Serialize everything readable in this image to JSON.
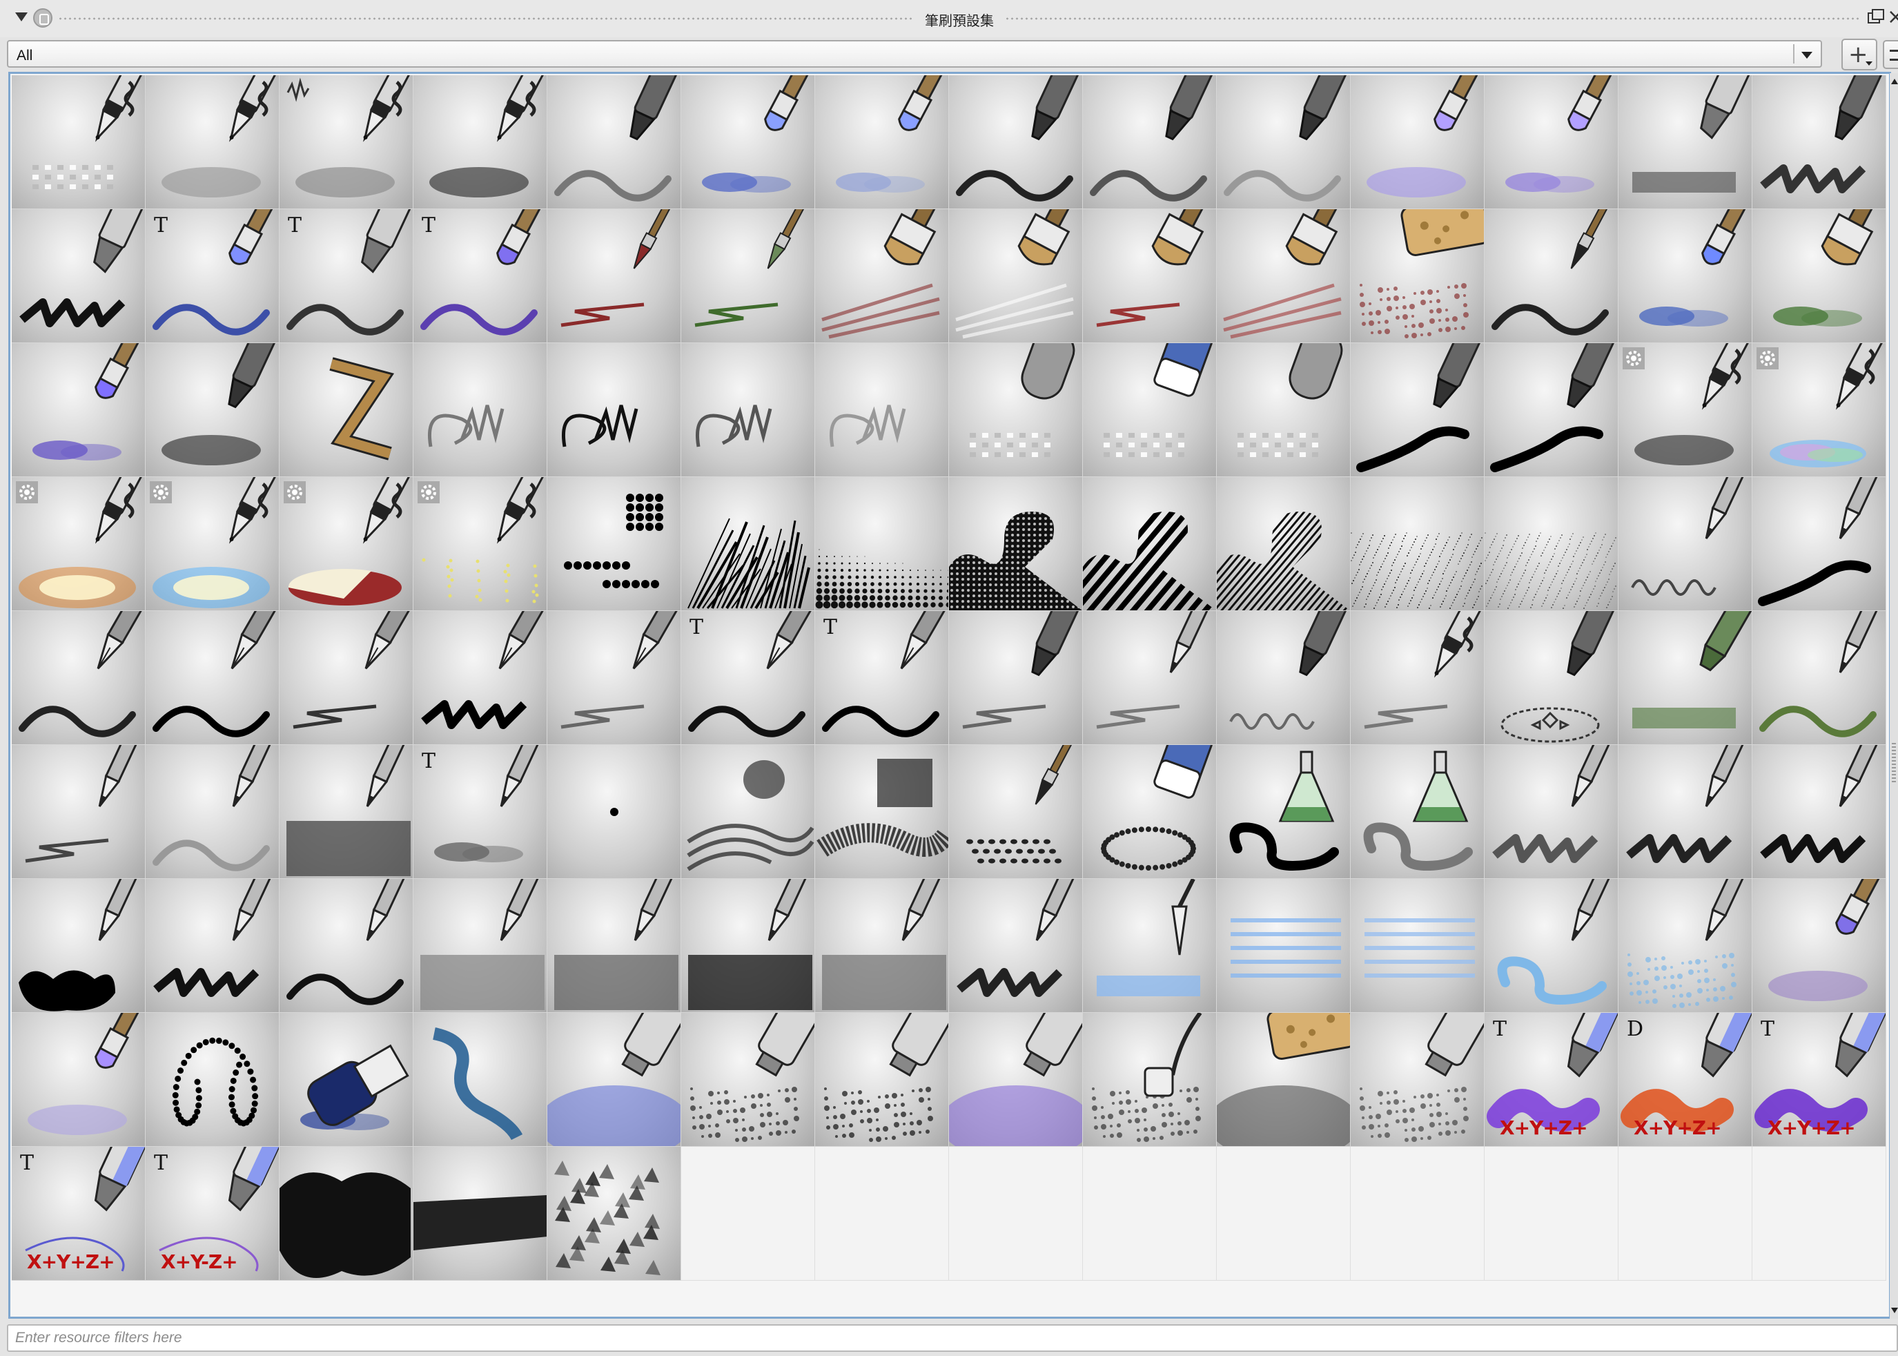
{
  "window": {
    "title": "筆刷預設集"
  },
  "tagbar": {
    "selected_tag": "All",
    "add_tag_symbol": "+"
  },
  "filter": {
    "placeholder": "Enter resource filters here"
  },
  "grid": {
    "columns": 14,
    "preset_count": 117,
    "presets": [
      {
        "icon": "pen-checker-icon",
        "style": "pen",
        "stroke": "checker",
        "ink": "#444"
      },
      {
        "icon": "pen-airbrush-soft-icon",
        "style": "pen",
        "stroke": "blob",
        "ink": "#9a9a9a"
      },
      {
        "icon": "pen-airbrush-noise-icon",
        "style": "pen",
        "stroke": "blob",
        "ink": "#8a8a8a",
        "badge": "wave"
      },
      {
        "icon": "pen-airbrush-dark-icon",
        "style": "pen",
        "stroke": "blob",
        "ink": "#333"
      },
      {
        "icon": "marker-gray-wave-icon",
        "style": "marker",
        "stroke": "wave",
        "ink": "#777"
      },
      {
        "icon": "brush-blue-wet-icon",
        "style": "brush",
        "stroke": "dabs",
        "ink": "#5a6ec8",
        "tip": "#8aa0ff"
      },
      {
        "icon": "brush-blue-light-icon",
        "style": "brush",
        "stroke": "dabs",
        "ink": "#9aa8d8",
        "tip": "#8aa0ff"
      },
      {
        "icon": "marker-black-blend-icon",
        "style": "marker",
        "stroke": "wave",
        "ink": "#222"
      },
      {
        "icon": "marker-gray-blend-icon",
        "style": "marker",
        "stroke": "wave",
        "ink": "#555"
      },
      {
        "icon": "marker-light-blend-icon",
        "style": "marker",
        "stroke": "wave",
        "ink": "#999"
      },
      {
        "icon": "brush-lavender-icon",
        "style": "brush",
        "stroke": "blob",
        "ink": "#a79be8",
        "tip": "#b2a0ff"
      },
      {
        "icon": "brush-lavender-dabs-icon",
        "style": "brush",
        "stroke": "dabs",
        "ink": "#9988dd",
        "tip": "#b2a0ff"
      },
      {
        "icon": "highlighter-gray-icon",
        "style": "highlighter",
        "stroke": "band",
        "ink": "#666"
      },
      {
        "icon": "marker-dark-scribble-icon",
        "style": "marker",
        "stroke": "scribble",
        "ink": "#333"
      },
      {
        "icon": "highlighter-black-scribble-icon",
        "style": "highlighter",
        "stroke": "scribble",
        "ink": "#111"
      },
      {
        "icon": "brush-blue-taper-icon",
        "style": "brush",
        "stroke": "wave",
        "ink": "#3c4fa8",
        "tip": "#8090ff",
        "badge": "T"
      },
      {
        "icon": "highlighter-gray-taper-icon",
        "style": "highlighter",
        "stroke": "wave",
        "ink": "#333",
        "badge": "T"
      },
      {
        "icon": "brush-purple-taper-icon",
        "style": "brush",
        "stroke": "wave",
        "ink": "#5b3fb0",
        "tip": "#8070f0",
        "badge": "T"
      },
      {
        "icon": "paintbrush-red-thin-icon",
        "style": "fine",
        "stroke": "zig",
        "ink": "#8a2a2a"
      },
      {
        "icon": "paintbrush-green-icon",
        "style": "fine",
        "stroke": "zig",
        "ink": "#3f6b2c",
        "tip": "#6b8a5a"
      },
      {
        "icon": "bristle-red-icon",
        "style": "bristle",
        "stroke": "streak",
        "ink": "#8a3030"
      },
      {
        "icon": "bristle-white-icon",
        "style": "bristle",
        "stroke": "streak",
        "ink": "#ffffff"
      },
      {
        "icon": "bristle-red-small-icon",
        "style": "bristle",
        "stroke": "zig",
        "ink": "#9a3535"
      },
      {
        "icon": "bristle-red-fan-icon",
        "style": "bristle",
        "stroke": "streak",
        "ink": "#a33b3b"
      },
      {
        "icon": "sponge-red-icon",
        "style": "sponge",
        "stroke": "speckle",
        "ink": "#8a3535"
      },
      {
        "icon": "paintbrush-black-icon",
        "style": "fine",
        "stroke": "wave",
        "ink": "#222"
      },
      {
        "icon": "brush-blue-dry-icon",
        "style": "brush",
        "stroke": "dabs",
        "ink": "#4f6bc0",
        "tip": "#6f8aff"
      },
      {
        "icon": "brush-green-dry-icon",
        "style": "bristle",
        "stroke": "dabs",
        "ink": "#4a7a3a"
      },
      {
        "icon": "brush-purple-dry-icon",
        "style": "brush",
        "stroke": "dabs",
        "ink": "#6a5ac8",
        "tip": "#8070ff"
      },
      {
        "icon": "charcoal-stick-icon",
        "style": "marker",
        "stroke": "blob",
        "ink": "#333"
      },
      {
        "icon": "ruler-zigzag-icon",
        "style": "ruler",
        "stroke": "none",
        "ink": "#b58a4a"
      },
      {
        "icon": "line-curl-soft-icon",
        "style": "none",
        "stroke": "curl",
        "ink": "#777"
      },
      {
        "icon": "line-curl-black-icon",
        "style": "none",
        "stroke": "curl",
        "ink": "#111"
      },
      {
        "icon": "line-curl-gray-icon",
        "style": "none",
        "stroke": "curl",
        "ink": "#555"
      },
      {
        "icon": "line-curl-light-icon",
        "style": "none",
        "stroke": "curl",
        "ink": "#999"
      },
      {
        "icon": "eraser-soft-checker-icon",
        "style": "eraser-round",
        "stroke": "checker",
        "ink": "#888"
      },
      {
        "icon": "eraser-block-checker-icon",
        "style": "eraser",
        "stroke": "checker",
        "ink": "#444"
      },
      {
        "icon": "eraser-gray-checker-icon",
        "style": "eraser-round",
        "stroke": "checker",
        "ink": "#555"
      },
      {
        "icon": "marker-black-thick-icon",
        "style": "marker",
        "stroke": "swoosh",
        "ink": "#000"
      },
      {
        "icon": "marker-black-curl-icon",
        "style": "marker",
        "stroke": "swoosh",
        "ink": "#000"
      },
      {
        "icon": "pen-gear-dark-icon",
        "style": "pen",
        "stroke": "blob",
        "ink": "#333",
        "badge": "gear"
      },
      {
        "icon": "pen-gear-rainbow-icon",
        "style": "pen",
        "stroke": "rainbow",
        "ink": "#88aadd",
        "badge": "gear"
      },
      {
        "icon": "pen-gear-fire-icon",
        "style": "pen",
        "stroke": "glow",
        "ink": "#e07a1a",
        "badge": "gear"
      },
      {
        "icon": "pen-gear-blue-glow-icon",
        "style": "pen",
        "stroke": "glow",
        "ink": "#4ab0ff",
        "badge": "gear"
      },
      {
        "icon": "pen-gear-split-icon",
        "style": "pen",
        "stroke": "split",
        "ink": "#9a2a2a",
        "badge": "gear"
      },
      {
        "icon": "pen-gear-sparkle-icon",
        "style": "pen",
        "stroke": "sparkle",
        "ink": "#e8e070",
        "badge": "gear"
      },
      {
        "icon": "dots-grid-icon",
        "style": "none",
        "stroke": "dotgrid",
        "ink": "#000"
      },
      {
        "icon": "texture-spikes-icon",
        "style": "none",
        "stroke": "spikes",
        "ink": "#000"
      },
      {
        "icon": "halftone-dots-icon",
        "style": "none",
        "stroke": "halftone",
        "ink": "#111"
      },
      {
        "icon": "pattern-dots-s-icon",
        "style": "none",
        "stroke": "s-dots",
        "ink": "#000"
      },
      {
        "icon": "pattern-stripes-s-icon",
        "style": "none",
        "stroke": "s-stripes",
        "ink": "#000"
      },
      {
        "icon": "pattern-lines-s-icon",
        "style": "none",
        "stroke": "s-lines",
        "ink": "#000"
      },
      {
        "icon": "texture-noise-dark-icon",
        "style": "none",
        "stroke": "noise",
        "ink": "#222"
      },
      {
        "icon": "texture-noise-light-icon",
        "style": "none",
        "stroke": "noise",
        "ink": "#555"
      },
      {
        "icon": "pencil-squiggle-icon",
        "style": "pencil",
        "stroke": "squiggle",
        "ink": "#444"
      },
      {
        "icon": "pencil-swoosh-icon",
        "style": "pencil",
        "stroke": "swoosh",
        "ink": "#000"
      },
      {
        "icon": "nib-thin-line-icon",
        "style": "nib",
        "stroke": "wave",
        "ink": "#222"
      },
      {
        "icon": "nib-bold-line-icon",
        "style": "nib",
        "stroke": "wave",
        "ink": "#000"
      },
      {
        "icon": "nib-gray-line-icon",
        "style": "nib",
        "stroke": "zig",
        "ink": "#333"
      },
      {
        "icon": "nib-scribble-icon",
        "style": "nib",
        "stroke": "scribble",
        "ink": "#000"
      },
      {
        "icon": "nib-light-zig-icon",
        "style": "nib",
        "stroke": "zig",
        "ink": "#666"
      },
      {
        "icon": "nib-taper-icon",
        "style": "nib",
        "stroke": "wave",
        "ink": "#111",
        "badge": "T"
      },
      {
        "icon": "nib-bold-taper-icon",
        "style": "nib",
        "stroke": "wave",
        "ink": "#000",
        "badge": "T"
      },
      {
        "icon": "marker-gray-zig-icon",
        "style": "marker",
        "stroke": "zig",
        "ink": "#666"
      },
      {
        "icon": "pencil-gray-zig-icon",
        "style": "pencil",
        "stroke": "zig",
        "ink": "#777"
      },
      {
        "icon": "marker-gray-squiggle-icon",
        "style": "marker",
        "stroke": "squiggle",
        "ink": "#666"
      },
      {
        "icon": "pen-grip-zig-icon",
        "style": "pen",
        "stroke": "zig",
        "ink": "#777"
      },
      {
        "icon": "pen-target-icon",
        "style": "marker",
        "stroke": "target",
        "ink": "#333"
      },
      {
        "icon": "crayon-green-icon",
        "style": "crayon",
        "stroke": "band",
        "ink": "#6a8a5a"
      },
      {
        "icon": "crayon-green-thin-icon",
        "style": "pencil",
        "stroke": "wave",
        "ink": "#5a7a3a"
      },
      {
        "icon": "pencil-dark-scribble-icon",
        "style": "pencil",
        "stroke": "zig",
        "ink": "#444"
      },
      {
        "icon": "pencil-light-line-icon",
        "style": "pencil",
        "stroke": "wave",
        "ink": "#999"
      },
      {
        "icon": "pencil-texture-fill-icon",
        "style": "pencil",
        "stroke": "fill",
        "ink": "#444"
      },
      {
        "icon": "pencil-texture-taper-icon",
        "style": "pencil",
        "stroke": "dabs",
        "ink": "#666",
        "badge": "T"
      },
      {
        "icon": "dot-single-icon",
        "style": "none",
        "stroke": "dot",
        "ink": "#000"
      },
      {
        "icon": "hatch-soft-icon",
        "style": "none",
        "stroke": "hatch",
        "ink": "#333"
      },
      {
        "icon": "hatch-cross-icon",
        "style": "none",
        "stroke": "crosshatch",
        "ink": "#222"
      },
      {
        "icon": "fountain-dots-icon",
        "style": "fine",
        "stroke": "dotrow",
        "ink": "#222"
      },
      {
        "icon": "eraser-halftone-icon",
        "style": "eraser",
        "stroke": "dotring",
        "ink": "#222"
      },
      {
        "icon": "flask-black-icon",
        "style": "flask",
        "stroke": "swirl",
        "ink": "#000"
      },
      {
        "icon": "flask-gray-icon",
        "style": "flask",
        "stroke": "swirl",
        "ink": "#777"
      },
      {
        "icon": "pencil-smudge-icon",
        "style": "pencil",
        "stroke": "scribble",
        "ink": "#555"
      },
      {
        "icon": "pencil-scratch-icon",
        "style": "pencil",
        "stroke": "scribble",
        "ink": "#222"
      },
      {
        "icon": "pencil-scratch-dark-icon",
        "style": "pencil",
        "stroke": "scribble",
        "ink": "#111"
      },
      {
        "icon": "pencil-ink-blot-icon",
        "style": "pencil",
        "stroke": "blot",
        "ink": "#000"
      },
      {
        "icon": "pencil-ink-sketch-icon",
        "style": "pencil",
        "stroke": "scribble",
        "ink": "#111"
      },
      {
        "icon": "pencil-ink-thin-icon",
        "style": "pencil",
        "stroke": "wave",
        "ink": "#111"
      },
      {
        "icon": "pencil-graphite-soft-icon",
        "style": "pencil",
        "stroke": "fill",
        "ink": "#888"
      },
      {
        "icon": "pencil-graphite-mid-icon",
        "style": "pencil",
        "stroke": "fill",
        "ink": "#666"
      },
      {
        "icon": "pencil-graphite-dark-icon",
        "style": "pencil",
        "stroke": "fill",
        "ink": "#111"
      },
      {
        "icon": "pencil-graphite-blur-icon",
        "style": "pencil",
        "stroke": "fill",
        "ink": "#777"
      },
      {
        "icon": "pencil-triangle-icon",
        "style": "pencil",
        "stroke": "scribble",
        "ink": "#222"
      },
      {
        "icon": "knife-blue-icon",
        "style": "knife",
        "stroke": "band",
        "ink": "#8ab8f0"
      },
      {
        "icon": "lines-blue-icon",
        "style": "none",
        "stroke": "bluelines",
        "ink": "#8ab8f0"
      },
      {
        "icon": "lines-blue-short-icon",
        "style": "none",
        "stroke": "bluelines",
        "ink": "#9ac0f0"
      },
      {
        "icon": "pencil-blue-swirl-icon",
        "style": "pencil",
        "stroke": "swirl",
        "ink": "#7fb8e8"
      },
      {
        "icon": "pencil-blue-splatter-icon",
        "style": "pencil",
        "stroke": "speckle",
        "ink": "#7fb8e8"
      },
      {
        "icon": "brush-purple-soft-icon",
        "style": "brush",
        "stroke": "blob",
        "ink": "#a08ac8",
        "tip": "#8070e8"
      },
      {
        "icon": "brush-lavender-soft-icon",
        "style": "brush",
        "stroke": "blob",
        "ink": "#b0a8e0",
        "tip": "#a890ff"
      },
      {
        "icon": "dotted-loop-icon",
        "style": "none",
        "stroke": "dotloop",
        "ink": "#000"
      },
      {
        "icon": "ink-bottle-blue-icon",
        "style": "bottle",
        "stroke": "dabs",
        "ink": "#3a4fa0"
      },
      {
        "icon": "ink-smoke-blue-icon",
        "style": "none",
        "stroke": "smoke",
        "ink": "#1f5a90"
      },
      {
        "icon": "spray-blue-icon",
        "style": "spray",
        "stroke": "cloud",
        "ink": "#6a7ad8"
      },
      {
        "icon": "spray-speckle-icon",
        "style": "spray",
        "stroke": "speckle",
        "ink": "#222"
      },
      {
        "icon": "spray-dark-speckle-icon",
        "style": "spray",
        "stroke": "speckle",
        "ink": "#111"
      },
      {
        "icon": "spray-purple-icon",
        "style": "spray",
        "stroke": "cloud",
        "ink": "#8a70d8"
      },
      {
        "icon": "stamp-speckle-icon",
        "style": "stamp",
        "stroke": "speckle",
        "ink": "#333"
      },
      {
        "icon": "sponge-gray-cloud-icon",
        "style": "sponge",
        "stroke": "cloud",
        "ink": "#555"
      },
      {
        "icon": "spray-light-speckle-icon",
        "style": "spray",
        "stroke": "speckle",
        "ink": "#444"
      },
      {
        "icon": "marker-xyz-purple-icon",
        "style": "xyz",
        "stroke": "xyz",
        "ink": "#7a3adc",
        "badge": "T",
        "label": "X+Y+Z+"
      },
      {
        "icon": "marker-xyz-rainbow-icon",
        "style": "xyz",
        "stroke": "xyz",
        "ink": "#e0501a",
        "badge": "D",
        "label": "X+Y+Z+"
      },
      {
        "icon": "marker-xyz-violet-icon",
        "style": "xyz",
        "stroke": "xyz",
        "ink": "#6a2ad0",
        "badge": "T",
        "label": "X+Y+Z+"
      },
      {
        "icon": "marker-xyz-line-icon",
        "style": "xyz",
        "stroke": "xyzline",
        "ink": "#5a5ad0",
        "badge": "T",
        "label": "X+Y+Z+"
      },
      {
        "icon": "marker-xyz-minus-icon",
        "style": "xyz",
        "stroke": "xyzline",
        "ink": "#8a5ad0",
        "badge": "T",
        "label": "X+Y-Z+"
      },
      {
        "icon": "texture-blot-icon",
        "style": "none",
        "stroke": "bigblot",
        "ink": "#111"
      },
      {
        "icon": "texture-bristle-strip-icon",
        "style": "none",
        "stroke": "strip",
        "ink": "#222"
      },
      {
        "icon": "foliage-icon",
        "style": "none",
        "stroke": "foliage",
        "ink": "#222"
      }
    ]
  }
}
